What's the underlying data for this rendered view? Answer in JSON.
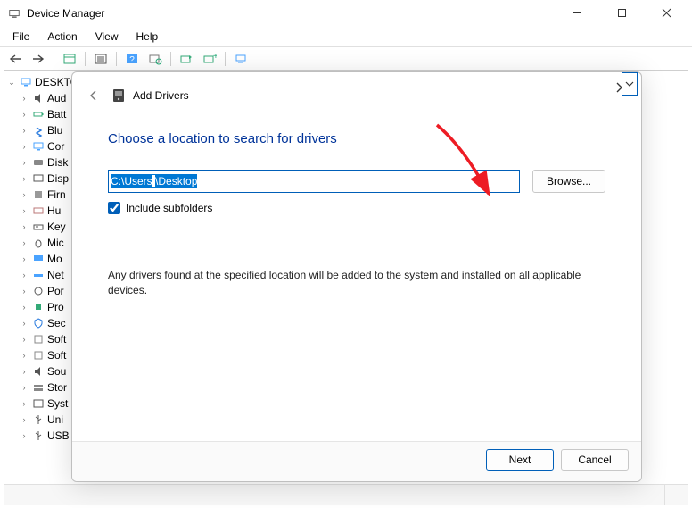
{
  "window": {
    "title": "Device Manager",
    "menu": [
      "File",
      "Action",
      "View",
      "Help"
    ]
  },
  "tree": {
    "root": "DESKTO",
    "items": [
      {
        "label": "Aud",
        "icon": "speaker"
      },
      {
        "label": "Batt",
        "icon": "battery"
      },
      {
        "label": "Blu",
        "icon": "bluetooth"
      },
      {
        "label": "Cor",
        "icon": "computer"
      },
      {
        "label": "Disk",
        "icon": "disk"
      },
      {
        "label": "Disp",
        "icon": "display"
      },
      {
        "label": "Firn",
        "icon": "firmware"
      },
      {
        "label": "Hu",
        "icon": "hid"
      },
      {
        "label": "Key",
        "icon": "keyboard"
      },
      {
        "label": "Mic",
        "icon": "mouse"
      },
      {
        "label": "Mo",
        "icon": "monitor"
      },
      {
        "label": "Net",
        "icon": "network"
      },
      {
        "label": "Por",
        "icon": "port"
      },
      {
        "label": "Pro",
        "icon": "cpu"
      },
      {
        "label": "Sec",
        "icon": "security"
      },
      {
        "label": "Soft",
        "icon": "software"
      },
      {
        "label": "Soft",
        "icon": "software"
      },
      {
        "label": "Sou",
        "icon": "speaker"
      },
      {
        "label": "Stor",
        "icon": "storage"
      },
      {
        "label": "Syst",
        "icon": "system"
      },
      {
        "label": "Uni",
        "icon": "usb"
      },
      {
        "label": "USB",
        "icon": "usb"
      }
    ]
  },
  "dialog": {
    "back_tooltip": "Back",
    "title": "Add Drivers",
    "close_tooltip": "Close",
    "heading": "Choose a location to search for drivers",
    "path_seg1": "C:\\Users",
    "path_seg2": "\\Desktop",
    "browse_label": "Browse...",
    "include_subfolders_label": "Include subfolders",
    "include_subfolders_checked": true,
    "info": "Any drivers found at the specified location will be added to the system and installed on all applicable devices.",
    "next_label": "Next",
    "cancel_label": "Cancel"
  }
}
